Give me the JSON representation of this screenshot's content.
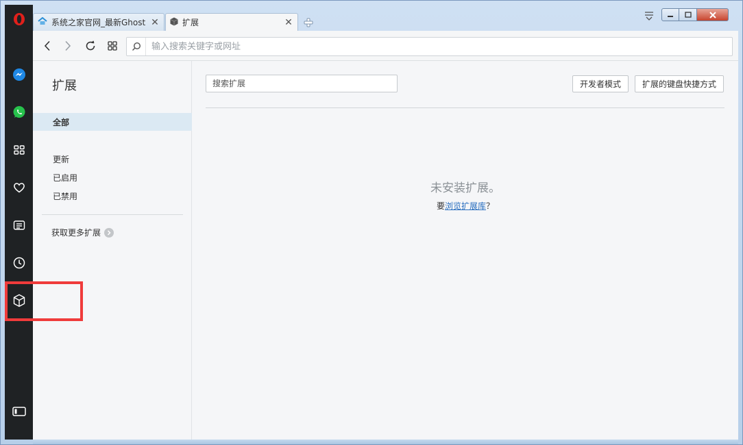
{
  "tabs": [
    {
      "title": "系统之家官网_最新Ghost",
      "favicon": "site-favicon"
    },
    {
      "title": "扩展",
      "favicon": "cube-icon"
    }
  ],
  "toolbar": {
    "address_placeholder": "输入搜索关键字或网址"
  },
  "sidebar": {
    "items": [
      "opera-logo",
      "messenger-icon",
      "whatsapp-icon",
      "speed-dial-icon",
      "heart-icon",
      "news-icon",
      "history-icon",
      "extensions-icon",
      "sidebar-toggle-icon"
    ]
  },
  "extensions_page": {
    "heading": "扩展",
    "nav": {
      "all": "全部",
      "updates": "更新",
      "enabled": "已启用",
      "disabled": "已禁用",
      "get_more": "获取更多扩展"
    },
    "search_placeholder": "搜索扩展",
    "dev_mode_button": "开发者模式",
    "shortcuts_button": "扩展的键盘快捷方式",
    "empty_title": "未安装扩展。",
    "empty_prefix": "要",
    "empty_link": "浏览扩展库",
    "empty_suffix": "？"
  },
  "colors": {
    "sidebar_bg": "#1f2224",
    "opera_red": "#e0201b",
    "active_nav_bg": "#dbe9f3",
    "link": "#2a6fbf",
    "annotation_red": "#ef3b3b"
  }
}
